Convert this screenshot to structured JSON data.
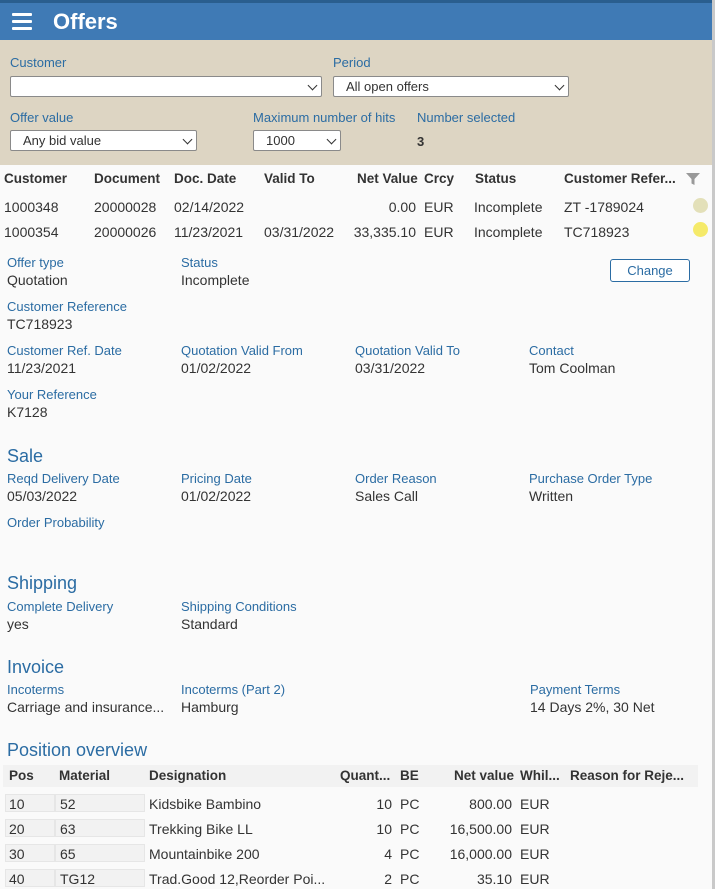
{
  "header": {
    "title": "Offers"
  },
  "filters": {
    "customer": {
      "label": "Customer",
      "value": ""
    },
    "period": {
      "label": "Period",
      "value": "All open offers"
    },
    "offer_value": {
      "label": "Offer value",
      "value": "Any bid value"
    },
    "max_hits": {
      "label": "Maximum number of hits",
      "value": "1000"
    },
    "number_selected": {
      "label": "Number selected",
      "value": "3"
    }
  },
  "offers": {
    "columns": [
      "Customer",
      "Document",
      "Doc. Date",
      "Valid To",
      "Net Value",
      "Crcy",
      "Status",
      "Customer Refer..."
    ],
    "rows": [
      {
        "customer": "1000348",
        "document": "20000028",
        "doc_date": "02/14/2022",
        "valid_to": "",
        "net_value": "0.00",
        "currency": "EUR",
        "status": "Incomplete",
        "customer_ref": "ZT -1789024",
        "indicator_color": "#e3e0b9"
      },
      {
        "customer": "1000354",
        "document": "20000026",
        "doc_date": "11/23/2021",
        "valid_to": "03/31/2022",
        "net_value": "33,335.10",
        "currency": "EUR",
        "status": "Incomplete",
        "customer_ref": "TC718923",
        "indicator_color": "#f5ea6a"
      }
    ]
  },
  "detail": {
    "change_label": "Change",
    "offer_type": {
      "label": "Offer type",
      "value": "Quotation"
    },
    "status": {
      "label": "Status",
      "value": "Incomplete"
    },
    "customer_reference": {
      "label": "Customer Reference",
      "value": "TC718923"
    },
    "customer_ref_date": {
      "label": "Customer Ref. Date",
      "value": "11/23/2021"
    },
    "quotation_valid_from": {
      "label": "Quotation Valid From",
      "value": "01/02/2022"
    },
    "quotation_valid_to": {
      "label": "Quotation Valid To",
      "value": "03/31/2022"
    },
    "contact": {
      "label": "Contact",
      "value": "Tom Coolman"
    },
    "your_reference": {
      "label": "Your Reference",
      "value": "K7128"
    }
  },
  "sale": {
    "title": "Sale",
    "reqd_delivery_date": {
      "label": "Reqd Delivery Date",
      "value": "05/03/2022"
    },
    "pricing_date": {
      "label": "Pricing Date",
      "value": "01/02/2022"
    },
    "order_reason": {
      "label": "Order Reason",
      "value": "Sales Call"
    },
    "purchase_order_type": {
      "label": "Purchase Order Type",
      "value": "Written"
    },
    "order_probability": {
      "label": "Order Probability",
      "value": ""
    }
  },
  "shipping": {
    "title": "Shipping",
    "complete_delivery": {
      "label": "Complete Delivery",
      "value": "yes"
    },
    "shipping_conditions": {
      "label": "Shipping Conditions",
      "value": "Standard"
    }
  },
  "invoice": {
    "title": "Invoice",
    "incoterms": {
      "label": "Incoterms",
      "value": "Carriage and insurance..."
    },
    "incoterms2": {
      "label": "Incoterms (Part 2)",
      "value": "Hamburg"
    },
    "payment_terms": {
      "label": "Payment Terms",
      "value": "14 Days 2%, 30 Net"
    }
  },
  "positions": {
    "title": "Position overview",
    "columns": [
      "Pos",
      "Material",
      "Designation",
      "Quant...",
      "BE",
      "Net value",
      "Whil...",
      "Reason for Reje..."
    ],
    "rows": [
      {
        "pos": "10",
        "material": "52",
        "designation": "Kidsbike Bambino",
        "quantity": "10",
        "unit": "PC",
        "net_value": "800.00",
        "currency": "EUR",
        "reason": ""
      },
      {
        "pos": "20",
        "material": "63",
        "designation": "Trekking Bike LL",
        "quantity": "10",
        "unit": "PC",
        "net_value": "16,500.00",
        "currency": "EUR",
        "reason": ""
      },
      {
        "pos": "30",
        "material": "65",
        "designation": "Mountainbike 200",
        "quantity": "4",
        "unit": "PC",
        "net_value": "16,000.00",
        "currency": "EUR",
        "reason": ""
      },
      {
        "pos": "40",
        "material": "TG12",
        "designation": "Trad.Good 12,Reorder Poi...",
        "quantity": "2",
        "unit": "PC",
        "net_value": "35.10",
        "currency": "EUR",
        "reason": ""
      }
    ]
  }
}
